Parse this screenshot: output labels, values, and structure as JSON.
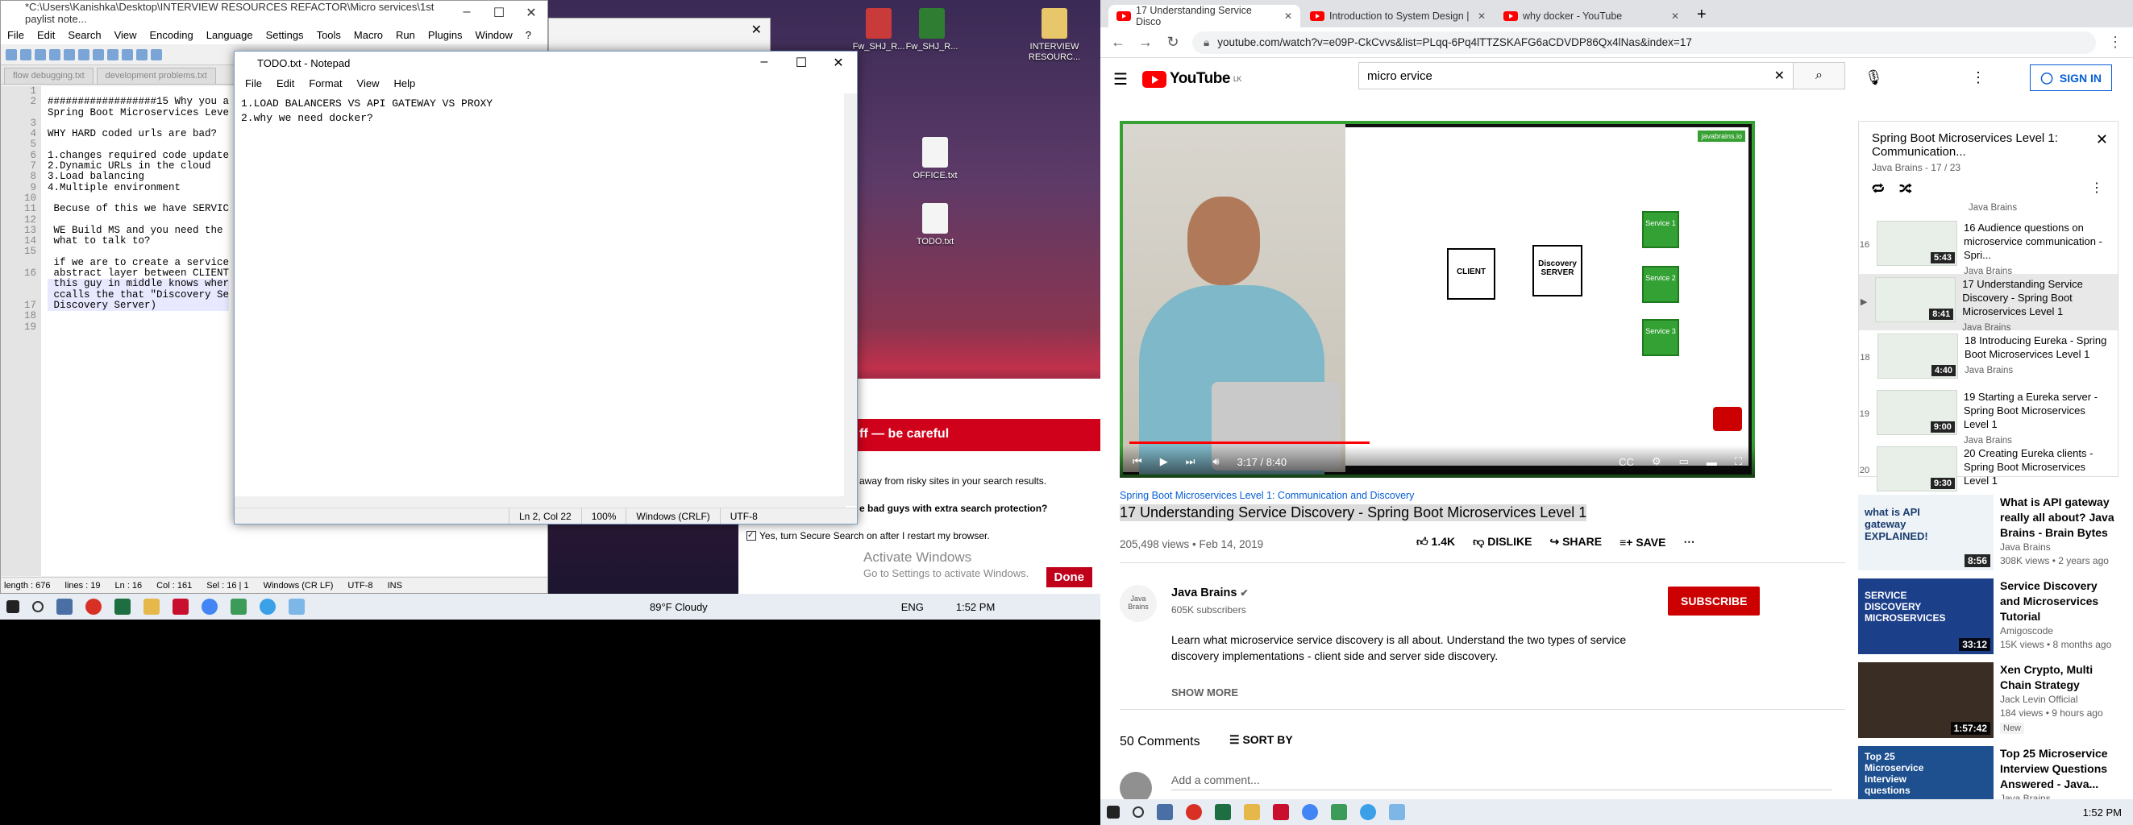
{
  "npp": {
    "title": "*C:\\Users\\Kanishka\\Desktop\\INTERVIEW RESOURCES REFACTOR\\Micro services\\1st paylist note...",
    "menu": [
      "File",
      "Edit",
      "Search",
      "View",
      "Encoding",
      "Language",
      "Settings",
      "Tools",
      "Macro",
      "Run",
      "Plugins",
      "Window",
      "?"
    ],
    "tabs": [
      "flow debugging.txt",
      "development problems.txt"
    ],
    "lines": [
      "1",
      "2",
      "",
      "3",
      "4",
      "5",
      "6",
      "7",
      "8",
      "9",
      "10",
      "11",
      "12",
      "13",
      "14",
      "15",
      "",
      "16",
      "",
      "",
      "17",
      "18",
      "19"
    ],
    "code": [
      "",
      "##################15 Why you a",
      "Spring Boot Microservices Leve",
      "",
      "WHY HARD coded urls are bad?",
      "",
      "1.changes required code update",
      "2.Dynamic URLs in the cloud",
      "3.Load balancing",
      "4.Multiple environment",
      "",
      " Becuse of this we have SERVIC",
      "",
      " WE Build MS and you need the",
      " what to talk to?",
      "",
      " if we are to create a service",
      " abstract layer between CLIENT",
      " this guy in middle knows wher",
      " ccalls the that \"Discovery Se",
      " Discovery Server)",
      "",
      ""
    ],
    "status": {
      "length": "length : 676",
      "lines": "lines : 19",
      "ln": "Ln : 16",
      "col": "Col : 161",
      "sel": "Sel : 16 | 1",
      "eol": "Windows (CR LF)",
      "enc": "UTF-8",
      "ins": "INS"
    }
  },
  "notepad": {
    "title": "TODO.txt - Notepad",
    "menu": [
      "File",
      "Edit",
      "Format",
      "View",
      "Help"
    ],
    "text": "1.LOAD BALANCERS VS API GATEWAY VS PROXY\n2.why we need docker?",
    "status": {
      "pos": "Ln 2, Col 22",
      "zoom": "100%",
      "eol": "Windows (CRLF)",
      "enc": "UTF-8"
    }
  },
  "desktop": {
    "icons": [
      {
        "label": "Fw_SHJ_R..."
      },
      {
        "label": "Fw_SHJ_R..."
      },
      {
        "label": "INTERVIEW RESOURC..."
      },
      {
        "label": "OFFICE.txt"
      },
      {
        "label": "TODO.txt"
      }
    ]
  },
  "security": {
    "header": "ff — be careful",
    "line1": "away from risky sites in your search results.",
    "line2": "e bad guys with extra search protection?",
    "check": "Yes, turn Secure Search on after I restart my browser.",
    "activate1": "Activate Windows",
    "activate2": "Go to Settings to activate Windows.",
    "done": "Done"
  },
  "taskbar_left": {
    "weather": "89°F  Cloudy",
    "lang": "ENG",
    "time": "1:52 PM"
  },
  "taskbar_right": {
    "time": "1:52 PM"
  },
  "browser": {
    "tabs": [
      {
        "label": "17 Understanding Service Disco"
      },
      {
        "label": "Introduction to System Design | "
      },
      {
        "label": "why docker - YouTube"
      }
    ],
    "url": "youtube.com/watch?v=e09P-CkCvvs&list=PLqq-6Pq4lTTZSKAFG6aCDVDP86Qx4lNas&index=17"
  },
  "yt": {
    "logo": "YouTube",
    "region": "LK",
    "search_value": "micro ervice",
    "signin": "SIGN IN",
    "player": {
      "watermark": "javabrains.io",
      "board": {
        "client": "CLIENT",
        "discovery": "Discovery SERVER",
        "services": [
          "Service 1",
          "Service 2",
          "Service 3"
        ]
      },
      "time": "3:17 / 8:40",
      "progress": 0.39
    },
    "playlist_link": "Spring Boot Microservices Level 1: Communication and Discovery",
    "video_title": "17 Understanding Service Discovery - Spring Boot Microservices Level 1",
    "views": "205,498 views • Feb 14, 2019",
    "likes": "1.4K",
    "dislike": "DISLIKE",
    "share": "SHARE",
    "save": "SAVE",
    "channel": {
      "name": "Java Brains",
      "subs": "605K subscribers",
      "avatar": "Java Brains"
    },
    "subscribe": "SUBSCRIBE",
    "description": "Learn what microservice service discovery is all about. Understand the two types of service discovery implementations - client side and server side discovery.",
    "show_more": "SHOW MORE",
    "comments": "50 Comments",
    "sort": "SORT BY",
    "add_comment": "Add a comment...",
    "playlist": {
      "title": "Spring Boot Microservices Level 1: Communication...",
      "meta": "Java Brains - 17 / 23",
      "top_channel": "Java Brains",
      "items": [
        {
          "n": "16",
          "title": "16 Audience questions on microservice communication - Spri...",
          "ch": "Java Brains",
          "dur": "5:43"
        },
        {
          "n": "▶",
          "title": "17 Understanding Service Discovery - Spring Boot Microservices Level 1",
          "ch": "Java Brains",
          "dur": "8:41"
        },
        {
          "n": "18",
          "title": "18 Introducing Eureka - Spring Boot Microservices Level 1",
          "ch": "Java Brains",
          "dur": "4:40"
        },
        {
          "n": "19",
          "title": "19 Starting a Eureka server - Spring Boot Microservices Level 1",
          "ch": "Java Brains",
          "dur": "9:00"
        },
        {
          "n": "20",
          "title": "20 Creating Eureka clients - Spring Boot Microservices Level 1",
          "ch": "",
          "dur": "9:30"
        }
      ]
    },
    "recs": [
      {
        "title": "What is API gateway really all about? Java Brains - Brain Bytes",
        "ch": "Java Brains",
        "meta": "308K views • 2 years ago",
        "dur": "8:56",
        "badge": "",
        "thumb": "what is API gateway EXPLAINED!"
      },
      {
        "title": "Service Discovery and Microservices Tutorial",
        "ch": "Amigoscode",
        "meta": "15K views • 8 months ago",
        "dur": "33:12",
        "badge": "",
        "thumb": "SERVICE DISCOVERY MICROSERVICES"
      },
      {
        "title": "Xen Crypto, Multi Chain Strategy",
        "ch": "Jack Levin Official",
        "meta": "184 views • 9 hours ago",
        "dur": "1:57:42",
        "badge": "New",
        "thumb": ""
      },
      {
        "title": "Top 25 Microservice Interview Questions Answered - Java...",
        "ch": "Java Brains",
        "meta": "",
        "dur": "",
        "badge": "",
        "thumb": "Top 25 Microservice Interview questions"
      }
    ]
  },
  "colors": {
    "yt_red": "#ff0000",
    "subscribe": "#cc0000",
    "notepad_accent": "#0078d7",
    "board_green": "#34a134"
  }
}
